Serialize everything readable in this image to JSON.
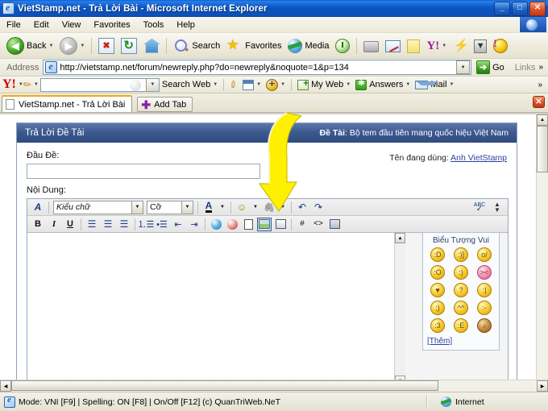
{
  "window": {
    "title": "VietStamp.net - Trả Lời Bài - Microsoft Internet Explorer",
    "icon": "ie-document-icon",
    "minimize": "_",
    "maximize": "□",
    "close": "✕"
  },
  "menu": {
    "items": [
      {
        "label": "File"
      },
      {
        "label": "Edit"
      },
      {
        "label": "View"
      },
      {
        "label": "Favorites"
      },
      {
        "label": "Tools"
      },
      {
        "label": "Help"
      }
    ]
  },
  "toolbar": {
    "back_label": "Back",
    "forward_label": "",
    "search_label": "Search",
    "favorites_label": "Favorites",
    "media_label": "Media",
    "dropdown_arrow": "▼"
  },
  "address": {
    "label": "Address",
    "url": "http://vietstamp.net/forum/newreply.php?do=newreply&noquote=1&p=134",
    "go_label": "Go",
    "links_label": "Links",
    "overflow": "»"
  },
  "yahoo_toolbar": {
    "logo": "Y!",
    "search_value": "",
    "search_web_label": "Search Web",
    "my_web_label": "My Web",
    "answers_label": "Answers",
    "mail_label": "Mail",
    "overflow": "»"
  },
  "tabs": {
    "items": [
      {
        "label": "VietStamp.net - Trả Lời Bài",
        "active": true
      }
    ],
    "add_tab_label": "Add Tab",
    "close_label": "✕"
  },
  "page": {
    "header": {
      "title": "Trả Lời Đề Tài",
      "thread_prefix": "Đề Tài",
      "thread_title": "Bộ tem đầu tiên mang quốc hiệu Việt Nam"
    },
    "form": {
      "subject_label": "Đầu Đề:",
      "subject_value": "",
      "body_label": "Nội Dung:",
      "body_value": "",
      "username_label": "Tên đang dùng:",
      "username": "Anh VietStamp"
    },
    "editor": {
      "row1": [
        {
          "name": "wysiwyg-toggle-icon",
          "glyph": "A"
        },
        {
          "name": "font-family-select",
          "label": "Kiểu chữ"
        },
        {
          "name": "font-size-select",
          "label": "Cỡ"
        },
        {
          "name": "font-color-icon",
          "glyph": "A"
        },
        {
          "name": "smilie-icon",
          "glyph": "☺"
        },
        {
          "name": "attachment-icon",
          "glyph": "📎"
        },
        {
          "name": "undo-icon",
          "glyph": "↶"
        },
        {
          "name": "redo-icon",
          "glyph": "↷"
        },
        {
          "name": "spellcheck-icon",
          "glyph": "ABC"
        },
        {
          "name": "collapse-toggle-icon",
          "glyph": "⇕"
        }
      ],
      "row2": [
        {
          "name": "bold-button",
          "glyph": "B"
        },
        {
          "name": "italic-button",
          "glyph": "I"
        },
        {
          "name": "underline-button",
          "glyph": "U"
        },
        {
          "name": "align-left-button",
          "glyph": "≡"
        },
        {
          "name": "align-center-button",
          "glyph": "≡"
        },
        {
          "name": "align-right-button",
          "glyph": "≡"
        },
        {
          "name": "ordered-list-button",
          "glyph": "1."
        },
        {
          "name": "unordered-list-button",
          "glyph": "•"
        },
        {
          "name": "outdent-button",
          "glyph": "⇤"
        },
        {
          "name": "indent-button",
          "glyph": "⇥"
        },
        {
          "name": "insert-link-button",
          "glyph": "🌐"
        },
        {
          "name": "remove-link-button",
          "glyph": "🌐"
        },
        {
          "name": "insert-email-button",
          "glyph": "✉"
        },
        {
          "name": "insert-image-button",
          "glyph": "🖼",
          "active": true
        },
        {
          "name": "insert-video-button",
          "glyph": "▣"
        },
        {
          "name": "insert-code-button",
          "glyph": "#"
        },
        {
          "name": "insert-html-button",
          "glyph": "<>"
        },
        {
          "name": "insert-quote-button",
          "glyph": "❝"
        }
      ],
      "font_placeholder": "Kiểu chữ",
      "size_placeholder": "Cỡ",
      "spellcheck_label": "ABC",
      "collapse_label": "⇕"
    },
    "smilies": {
      "title": "Biểu Tượng Vui",
      "more_label": "[Thêm]",
      "items": [
        {
          "name": "smilie-biggrin",
          "glyph": ":D"
        },
        {
          "name": "smilie-lol",
          "glyph": ":)]"
        },
        {
          "name": "smilie-wave",
          "glyph": "o/"
        },
        {
          "name": "smilie-surprised",
          "glyph": ":O"
        },
        {
          "name": "smilie-smile",
          "glyph": ":)"
        },
        {
          "name": "smilie-pink",
          "glyph": "><"
        },
        {
          "name": "smilie-love",
          "glyph": "♥"
        },
        {
          "name": "smilie-confused",
          "glyph": "?"
        },
        {
          "name": "smilie-neutral",
          "glyph": ":|"
        },
        {
          "name": "smilie-wink",
          "glyph": ";)"
        },
        {
          "name": "smilie-blush",
          "glyph": "^^"
        },
        {
          "name": "smilie-plain",
          "glyph": ":-"
        },
        {
          "name": "smilie-grin",
          "glyph": ":3"
        },
        {
          "name": "smilie-teeth",
          "glyph": ":E"
        },
        {
          "name": "smilie-party",
          "glyph": "♪"
        }
      ]
    }
  },
  "status": {
    "left_text": "Mode: VNI [F9] | Spelling: ON [F8] | On/Off [F12] (c) QuanTriWeb.NeT",
    "zone_text": "Internet"
  },
  "annotation": {
    "type": "yellow-arrow",
    "points_to": "insert-image-button",
    "color": "#FFF000"
  },
  "colors": {
    "titlebar_blue": "#0A55C4",
    "panel_header_blue": "#3D5A8F",
    "link_blue": "#2D3F9F",
    "chrome_beige": "#ECE9D8",
    "arrow_yellow": "#FFF000"
  }
}
